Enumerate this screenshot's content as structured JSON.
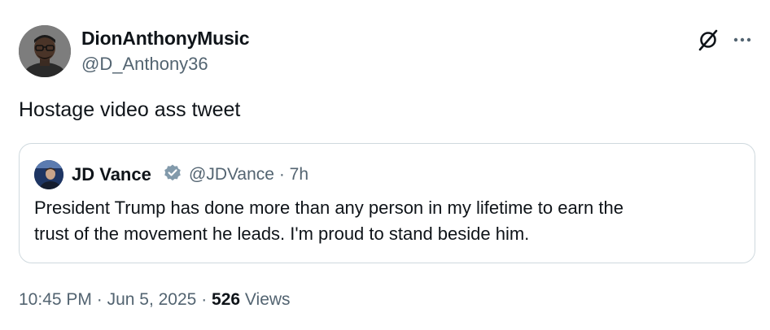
{
  "author": {
    "display_name": "DionAnthonyMusic",
    "handle": "@D_Anthony36"
  },
  "tweet": {
    "text": "Hostage video ass tweet"
  },
  "quoted": {
    "display_name": "JD Vance",
    "handle": "@JDVance",
    "separator": "·",
    "time": "7h",
    "line1": "President Trump has done more than any person in my lifetime to earn the",
    "line2": "trust of the movement he leads. I'm proud to stand beside him."
  },
  "footer": {
    "time": "10:45 PM",
    "sep1": "·",
    "date": "Jun 5, 2025",
    "sep2": "·",
    "views_count": "526",
    "views_label": "Views"
  },
  "icons": {
    "grok": "grok-icon",
    "more": "more-icon",
    "verified": "verified-badge-icon"
  },
  "colors": {
    "text": "#0f1419",
    "secondary": "#536471",
    "border": "#cfd9de",
    "verified_badge": "#829aab"
  }
}
